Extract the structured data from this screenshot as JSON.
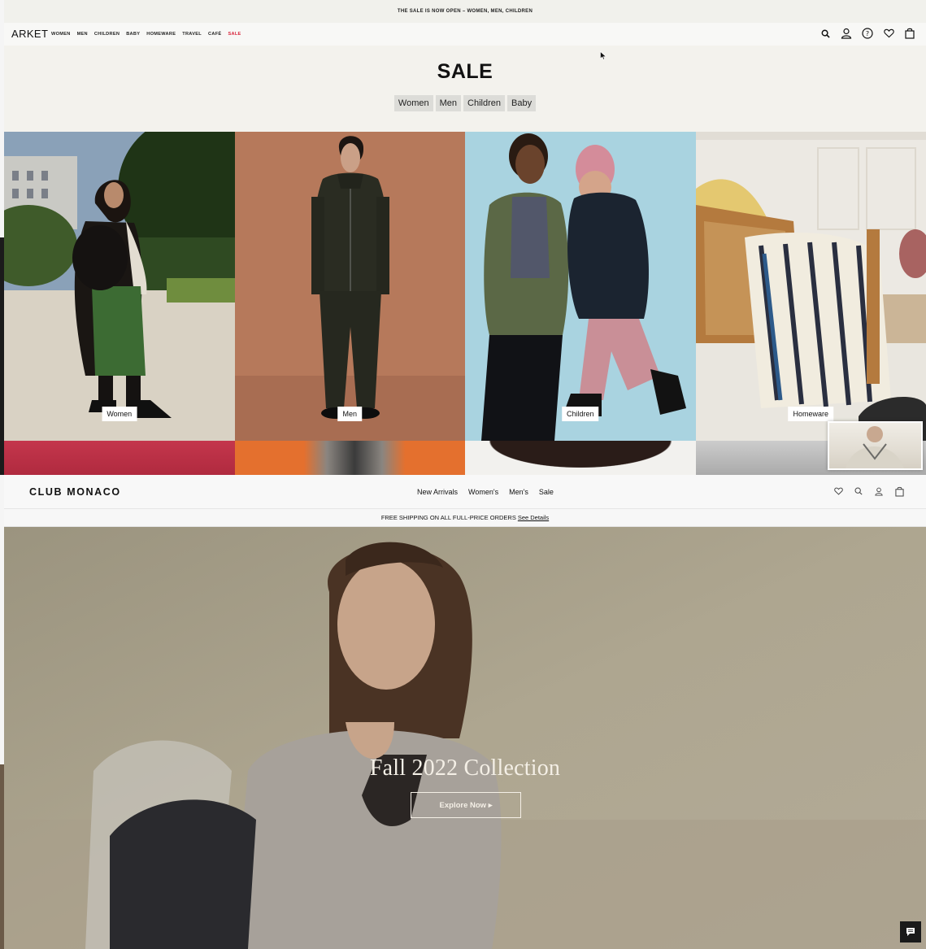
{
  "arket": {
    "announcement": "THE SALE IS NOW OPEN – WOMEN, MEN, CHILDREN",
    "logo": "ARKET",
    "menu": [
      "WOMEN",
      "MEN",
      "CHILDREN",
      "BABY",
      "HOMEWARE",
      "TRAVEL",
      "CAFÉ",
      "SALE"
    ],
    "title": "SALE",
    "tabs": [
      "Women",
      "Men",
      "Children",
      "Baby"
    ],
    "tiles": [
      "Women",
      "Men",
      "Children",
      "Homeware"
    ],
    "colors": {
      "sale": "#d8233a",
      "background": "#f3f2ed"
    }
  },
  "clubmonaco": {
    "logo": "CLUB MONACO",
    "menu": [
      "New Arrivals",
      "Women's",
      "Men's",
      "Sale"
    ],
    "shipping_text": "FREE SHIPPING ON ALL FULL-PRICE ORDERS",
    "shipping_link": "See Details",
    "hero_title": "Fall 2022 Collection",
    "hero_button": "Explore Now ▸"
  }
}
